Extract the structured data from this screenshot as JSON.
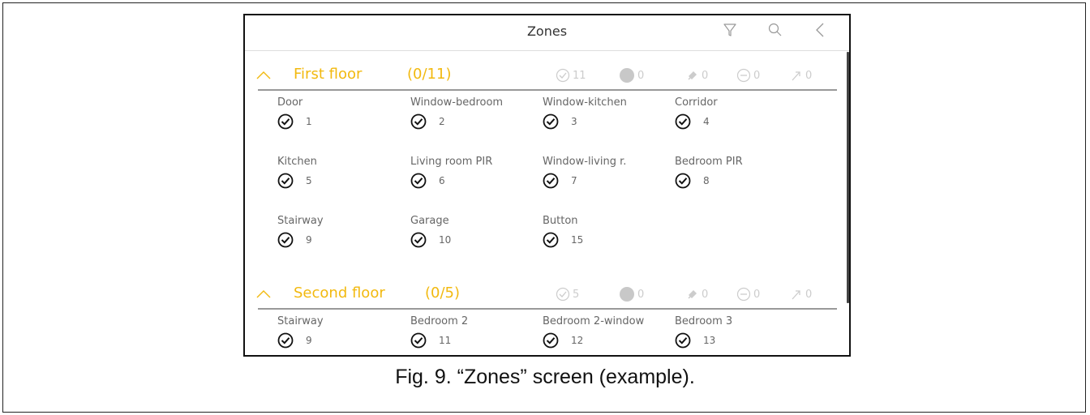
{
  "screen": {
    "title": "Zones",
    "icons": [
      "filter-icon",
      "search-icon",
      "back-icon"
    ]
  },
  "colors": {
    "accent": "#f2b90f",
    "muted": "#cccccc",
    "text": "#666666"
  },
  "sections": [
    {
      "title": "First floor",
      "count": "(0/11)",
      "stats": {
        "ok": "11",
        "violated": "0",
        "tamper": "0",
        "bypassed": "0",
        "alarm": "0"
      },
      "zones": [
        {
          "name": "Door",
          "number": "1"
        },
        {
          "name": "Window-bedroom",
          "number": "2"
        },
        {
          "name": "Window-kitchen",
          "number": "3"
        },
        {
          "name": "Corridor",
          "number": "4"
        },
        {
          "name": "Kitchen",
          "number": "5"
        },
        {
          "name": "Living room PIR",
          "number": "6"
        },
        {
          "name": "Window-living r.",
          "number": "7"
        },
        {
          "name": "Bedroom PIR",
          "number": "8"
        },
        {
          "name": "Stairway",
          "number": "9"
        },
        {
          "name": "Garage",
          "number": "10"
        },
        {
          "name": "Button",
          "number": "15"
        }
      ]
    },
    {
      "title": "Second floor",
      "count": "(0/5)",
      "stats": {
        "ok": "5",
        "violated": "0",
        "tamper": "0",
        "bypassed": "0",
        "alarm": "0"
      },
      "zones": [
        {
          "name": "Stairway",
          "number": "9"
        },
        {
          "name": "Bedroom 2",
          "number": "11"
        },
        {
          "name": "Bedroom 2-window",
          "number": "12"
        },
        {
          "name": "Bedroom 3",
          "number": "13"
        }
      ]
    }
  ],
  "caption": "Fig. 9. “Zones” screen (example)."
}
